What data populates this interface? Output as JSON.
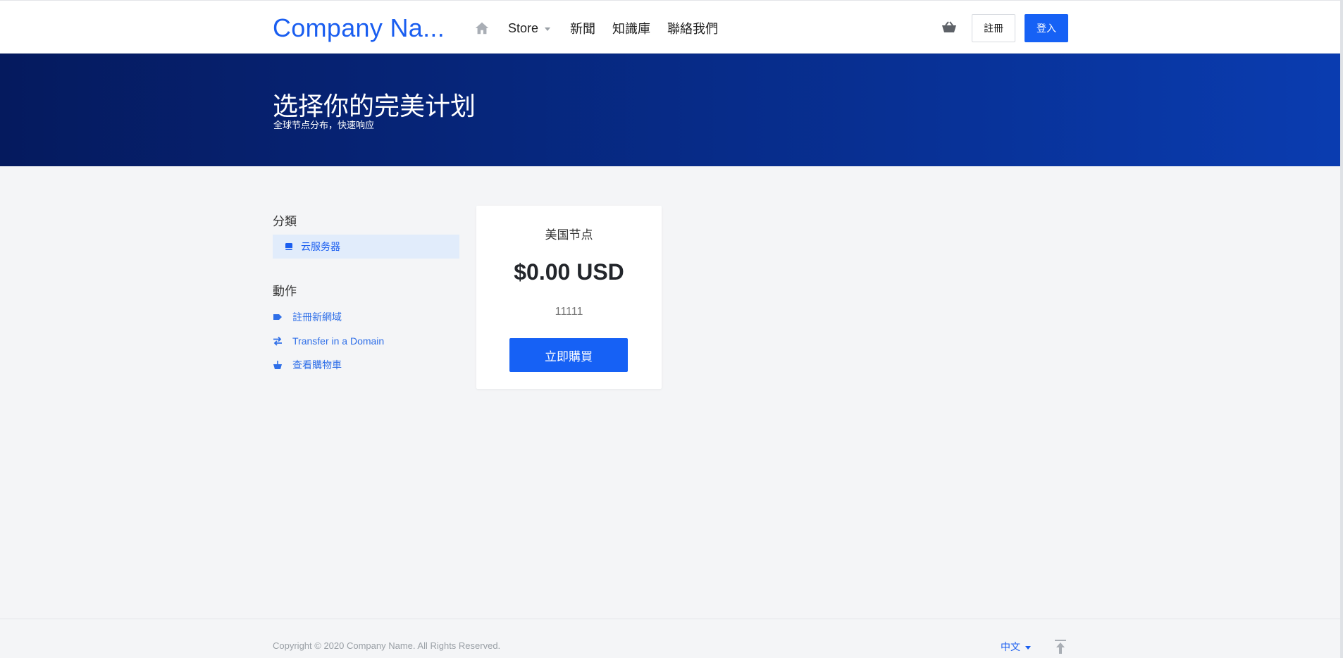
{
  "header": {
    "logo": "Company Na...",
    "nav": {
      "home_icon": "home-icon",
      "store": "Store",
      "news": "新聞",
      "knowledgebase": "知識庫",
      "contact": "聯絡我們"
    },
    "cart_icon": "basket-icon",
    "register": "註冊",
    "login": "登入"
  },
  "hero": {
    "title": "选择你的完美计划",
    "subtitle": "全球节点分布，快速响应"
  },
  "sidebar": {
    "categories_heading": "分類",
    "categories": [
      {
        "label": "云服务器",
        "icon": "box-icon",
        "active": true
      }
    ],
    "actions_heading": "動作",
    "actions": [
      {
        "label": "註冊新網域",
        "icon": "tag-icon"
      },
      {
        "label": "Transfer in a Domain",
        "icon": "transfer-arrows-icon"
      },
      {
        "label": "查看購物車",
        "icon": "basket-icon"
      }
    ]
  },
  "product": {
    "name": "美国节点",
    "price": "$0.00 USD",
    "description": "11111",
    "buy_button": "立即購買"
  },
  "footer": {
    "copyright": "Copyright © 2020 Company Name. All Rights Reserved.",
    "language": "中文",
    "back_to_top_icon": "arrow-up-to-top-icon"
  },
  "colors": {
    "accent": "#1661f5",
    "link": "#1a5ef0",
    "hero_start": "#051a5e",
    "hero_end": "#0a3cb0",
    "page_bg": "#f4f5f7"
  }
}
